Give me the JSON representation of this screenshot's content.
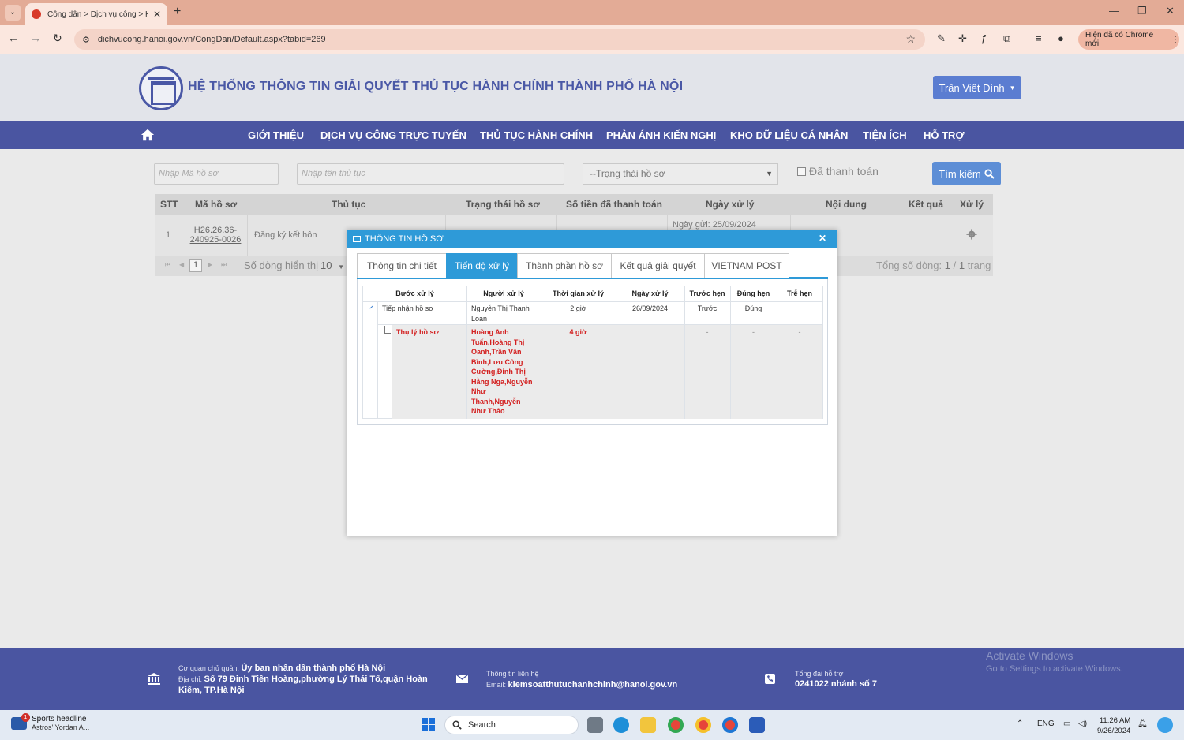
{
  "browser": {
    "tab_title": "Công dân > Dịch vụ công > Kh",
    "url": "dichvucong.hanoi.gov.vn/CongDan/Default.aspx?tabid=269",
    "update_label": "Hiện đã có Chrome mới"
  },
  "site": {
    "title": "HỆ THỐNG THÔNG TIN GIẢI QUYẾT THỦ TỤC HÀNH CHÍNH THÀNH PHỐ HÀ NỘI",
    "user": "Trần Viết Đình"
  },
  "nav": {
    "items": [
      "GIỚI THIỆU",
      "DỊCH VỤ CÔNG TRỰC TUYẾN",
      "THỦ TỤC HÀNH CHÍNH",
      "PHẢN ÁNH KIẾN NGHỊ",
      "KHO DỮ LIỆU CÁ NHÂN",
      "TIỆN ÍCH",
      "HỖ TRỢ"
    ]
  },
  "search": {
    "code_placeholder": "Nhập Mã hồ sơ",
    "name_placeholder": "Nhập tên thủ tục",
    "status_select": "--Trạng thái hồ sơ",
    "paid_label": "Đã thanh toán",
    "button": "Tìm kiếm"
  },
  "list": {
    "headers": [
      "STT",
      "Mã hồ sơ",
      "Thủ tục",
      "Trạng thái hồ sơ",
      "Số tiền đã thanh toán",
      "Ngày xử lý",
      "Nội dung",
      "Kết quả",
      "Xử lý"
    ],
    "row": {
      "stt": "1",
      "code_line1": "H26.26.36-",
      "code_line2": "240925-0026",
      "procedure": "Đăng ký kết hôn",
      "date": "Ngày gửi: 25/09/2024"
    },
    "pager": {
      "page": "1",
      "rows_label": "Số dòng hiển thị",
      "rows_value": "10",
      "total_label": "Tổng số dòng:",
      "total_count": "1",
      "total_pages": "1",
      "pages_word": "trang"
    }
  },
  "modal": {
    "title": "THÔNG TIN HỒ SƠ",
    "tabs": [
      "Thông tin chi tiết",
      "Tiến độ xử lý",
      "Thành phần hồ sơ",
      "Kết quả giải quyết",
      "VIETNAM POST"
    ],
    "active_tab": "Tiến độ xử lý",
    "table": {
      "headers": [
        "Bước xử lý",
        "Người xử lý",
        "Thời gian xử lý",
        "Ngày xử lý",
        "Trước hẹn",
        "Đúng hẹn",
        "Trễ hẹn"
      ],
      "rows": [
        {
          "step": "Tiếp nhận hồ sơ",
          "handler_lines": [
            "Nguyễn Thị Thanh",
            "Loan"
          ],
          "time": "2 giờ",
          "date": "26/09/2024",
          "early": "Trước",
          "ontime": "Đúng",
          "late": ""
        },
        {
          "step": "Thụ lý hồ sơ",
          "handler_lines": [
            "Hoàng Anh",
            "Tuấn,Hoàng Thị",
            "Oanh,Trần Văn",
            "Bình,Lưu Công",
            "Cường,Đinh Thị",
            "Hằng Nga,Nguyễn",
            "Như",
            "Thanh,Nguyễn",
            "Như Thảo"
          ],
          "time": "4 giờ",
          "date": "",
          "early": "-",
          "ontime": "-",
          "late": "-"
        }
      ]
    }
  },
  "footer": {
    "agency_label": "Cơ quan chủ quản:",
    "agency_value": "Ủy ban nhân dân thành phố Hà Nội",
    "address_label": "Địa chỉ:",
    "address_line1": "Số 79 Đinh Tiên Hoàng,phường Lý Thái Tổ,quận Hoàn",
    "address_line2": "Kiếm, TP.Hà Nội",
    "contact_label": "Thông tin liên hệ",
    "email_label": "Email:",
    "email_value": "kiemsoatthutuchanhchinh@hanoi.gov.vn",
    "hotline_label": "Tổng đài hỗ trợ",
    "hotline_value": "0241022 nhánh số 7"
  },
  "activation": {
    "line1": "Activate Windows",
    "line2": "Go to Settings to activate Windows."
  },
  "taskbar": {
    "news_title": "Sports headline",
    "news_sub": "Astros' Yordan A...",
    "search": "Search",
    "lang": "ENG",
    "time": "11:26 AM",
    "date": "9/26/2024"
  },
  "colors": {
    "nav_bg": "#4a55a1",
    "modal_accent": "#2e9ad8",
    "search_button": "#5d8ed6",
    "alert_red": "#d32020"
  }
}
